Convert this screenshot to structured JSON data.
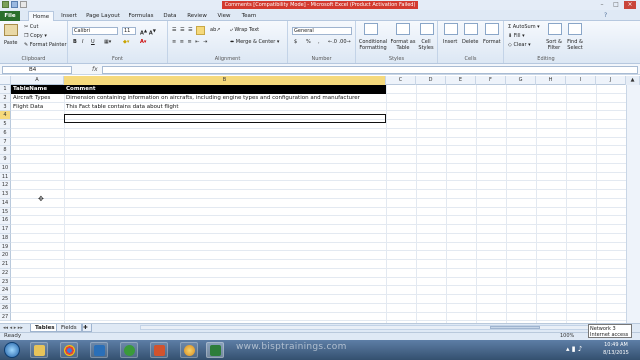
{
  "window": {
    "title": "Comments [Compatibility Mode] - Microsoft Excel (Product Activation Failed)"
  },
  "ribbon_tabs": [
    {
      "label": "File"
    },
    {
      "label": "Home"
    },
    {
      "label": "Insert"
    },
    {
      "label": "Page Layout"
    },
    {
      "label": "Formulas"
    },
    {
      "label": "Data"
    },
    {
      "label": "Review"
    },
    {
      "label": "View"
    },
    {
      "label": "Team"
    }
  ],
  "clipboard": {
    "paste": "Paste",
    "cut": "Cut",
    "copy": "Copy",
    "format_painter": "Format Painter",
    "label": "Clipboard"
  },
  "font": {
    "name": "Calibri",
    "size": "11",
    "label": "Font",
    "bold": "B",
    "italic": "I",
    "underline": "U"
  },
  "alignment": {
    "wrap": "Wrap Text",
    "merge": "Merge & Center",
    "label": "Alignment"
  },
  "number": {
    "format": "General",
    "label": "Number",
    "currency": "$",
    "percent": "%",
    "comma": ","
  },
  "styles": {
    "cond": "Conditional Formatting",
    "table": "Format as Table",
    "cell": "Cell Styles",
    "label": "Styles"
  },
  "cells": {
    "insert": "Insert",
    "delete": "Delete",
    "format": "Format",
    "label": "Cells"
  },
  "editing": {
    "autosum": "AutoSum",
    "fill": "Fill",
    "clear": "Clear",
    "sort": "Sort & Filter",
    "find": "Find & Select",
    "label": "Editing"
  },
  "formula_bar": {
    "name_box": "B4",
    "fx": "fx",
    "formula": ""
  },
  "columns": [
    {
      "label": "A"
    },
    {
      "label": "B"
    },
    {
      "label": "C"
    },
    {
      "label": "D"
    },
    {
      "label": "E"
    },
    {
      "label": "F"
    },
    {
      "label": "G"
    },
    {
      "label": "H"
    },
    {
      "label": "I"
    },
    {
      "label": "J"
    }
  ],
  "rows": [
    "1",
    "2",
    "3",
    "4",
    "5",
    "6",
    "7",
    "8",
    "9",
    "10",
    "11",
    "12",
    "13",
    "14",
    "15",
    "16",
    "17",
    "18",
    "19",
    "20",
    "21",
    "22",
    "23",
    "24",
    "25",
    "26",
    "27"
  ],
  "cells_data": [
    {
      "a": "TableName",
      "b": "Comment"
    },
    {
      "a": "Aircraft Types",
      "b": "Dimension containing information on aircrafts, including engine types and configuration and manufacturer"
    },
    {
      "a": "Flight Data",
      "b": "This Fact table contains data about flight"
    }
  ],
  "sheets": [
    {
      "label": "Tables"
    },
    {
      "label": "Fields"
    }
  ],
  "status": {
    "ready": "Ready",
    "zoom": "100%"
  },
  "tray": {
    "network": "Network 3",
    "access": "Internet access",
    "time": "10:49 AM",
    "date": "8/13/2015"
  },
  "watermark": "www.bisptrainings.com"
}
